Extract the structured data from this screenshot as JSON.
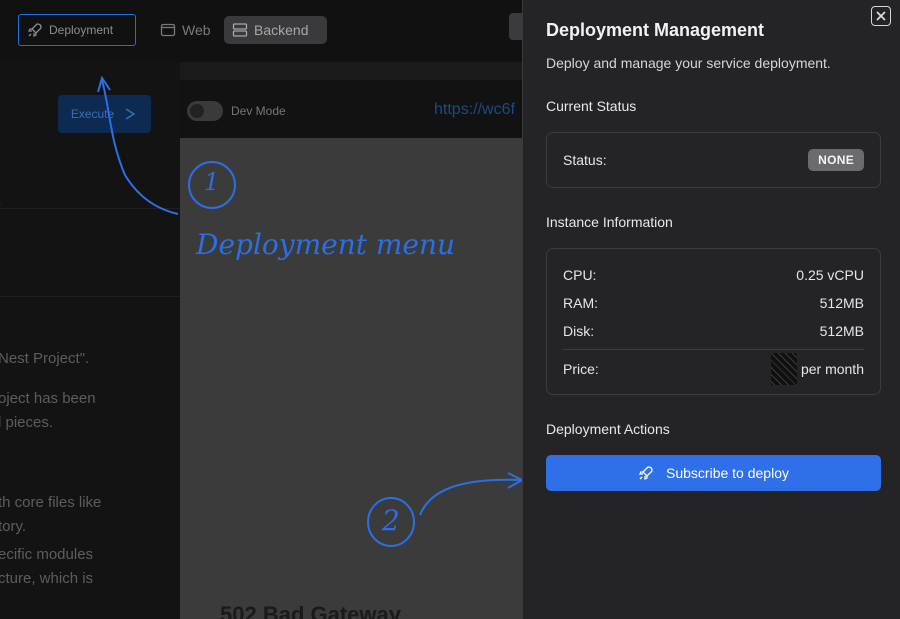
{
  "topbar": {
    "deployment_label": "Deployment",
    "web_label": "Web",
    "backend_label": "Backend"
  },
  "left_pane": {
    "execute_label": "Execute",
    "chat_lines": [
      "Nest Project\".",
      "oject has been",
      "l pieces.",
      "th core files like",
      "tory.",
      "ecific modules",
      "cture, which is"
    ]
  },
  "preview": {
    "dev_mode_label": "Dev Mode",
    "url": "https://wc6f",
    "error_text": "502 Bad Gateway"
  },
  "annotations": {
    "step1_number": "1",
    "step1_text": "Deployment menu",
    "step2_number": "2"
  },
  "drawer": {
    "title": "Deployment Management",
    "subtitle": "Deploy and manage your service deployment.",
    "current_status": {
      "heading": "Current Status",
      "label": "Status:",
      "value": "NONE"
    },
    "instance": {
      "heading": "Instance Information",
      "rows": [
        {
          "label": "CPU:",
          "value": "0.25 vCPU"
        },
        {
          "label": "RAM:",
          "value": "512MB"
        },
        {
          "label": "Disk:",
          "value": "512MB"
        }
      ],
      "price_label": "Price:",
      "price_suffix": "per month"
    },
    "actions": {
      "heading": "Deployment Actions",
      "subscribe_label": "Subscribe to deploy"
    }
  },
  "colors": {
    "accent": "#2f6fe8",
    "annotation": "#2a6fe6",
    "drawer_bg": "#242426",
    "badge_bg": "#6b6b6f"
  }
}
